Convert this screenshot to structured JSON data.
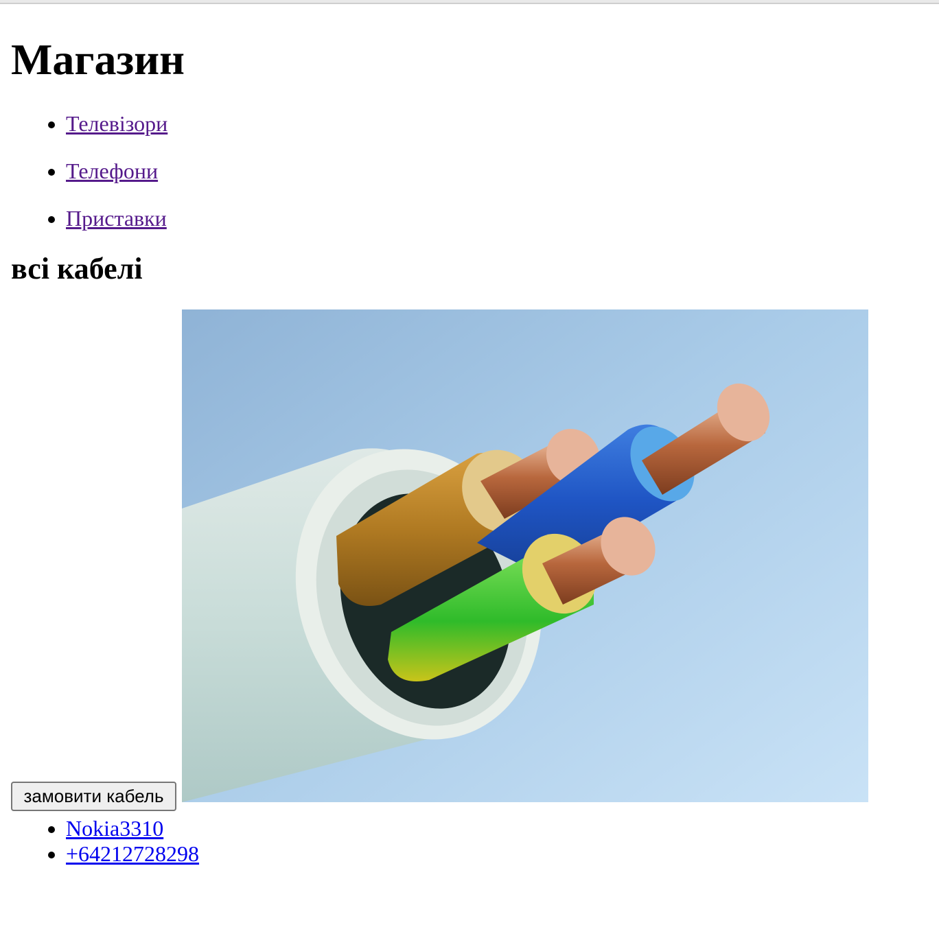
{
  "page": {
    "title": "Магазин",
    "nav": [
      {
        "label": "Телевізори"
      },
      {
        "label": "Телефони"
      },
      {
        "label": "Приставки"
      }
    ],
    "section_title": "всі кабелі",
    "product": {
      "image_alt": "cable-photo",
      "order_button_label": "замовити кабель"
    },
    "contacts": [
      {
        "label": "Nokia3310"
      },
      {
        "label": "+64212728298"
      }
    ]
  },
  "colors": {
    "visited_link": "#551a8b",
    "link": "#0000ee",
    "button_bg": "#efefef"
  },
  "icons": {
    "list_marker": "bullet-icon"
  }
}
